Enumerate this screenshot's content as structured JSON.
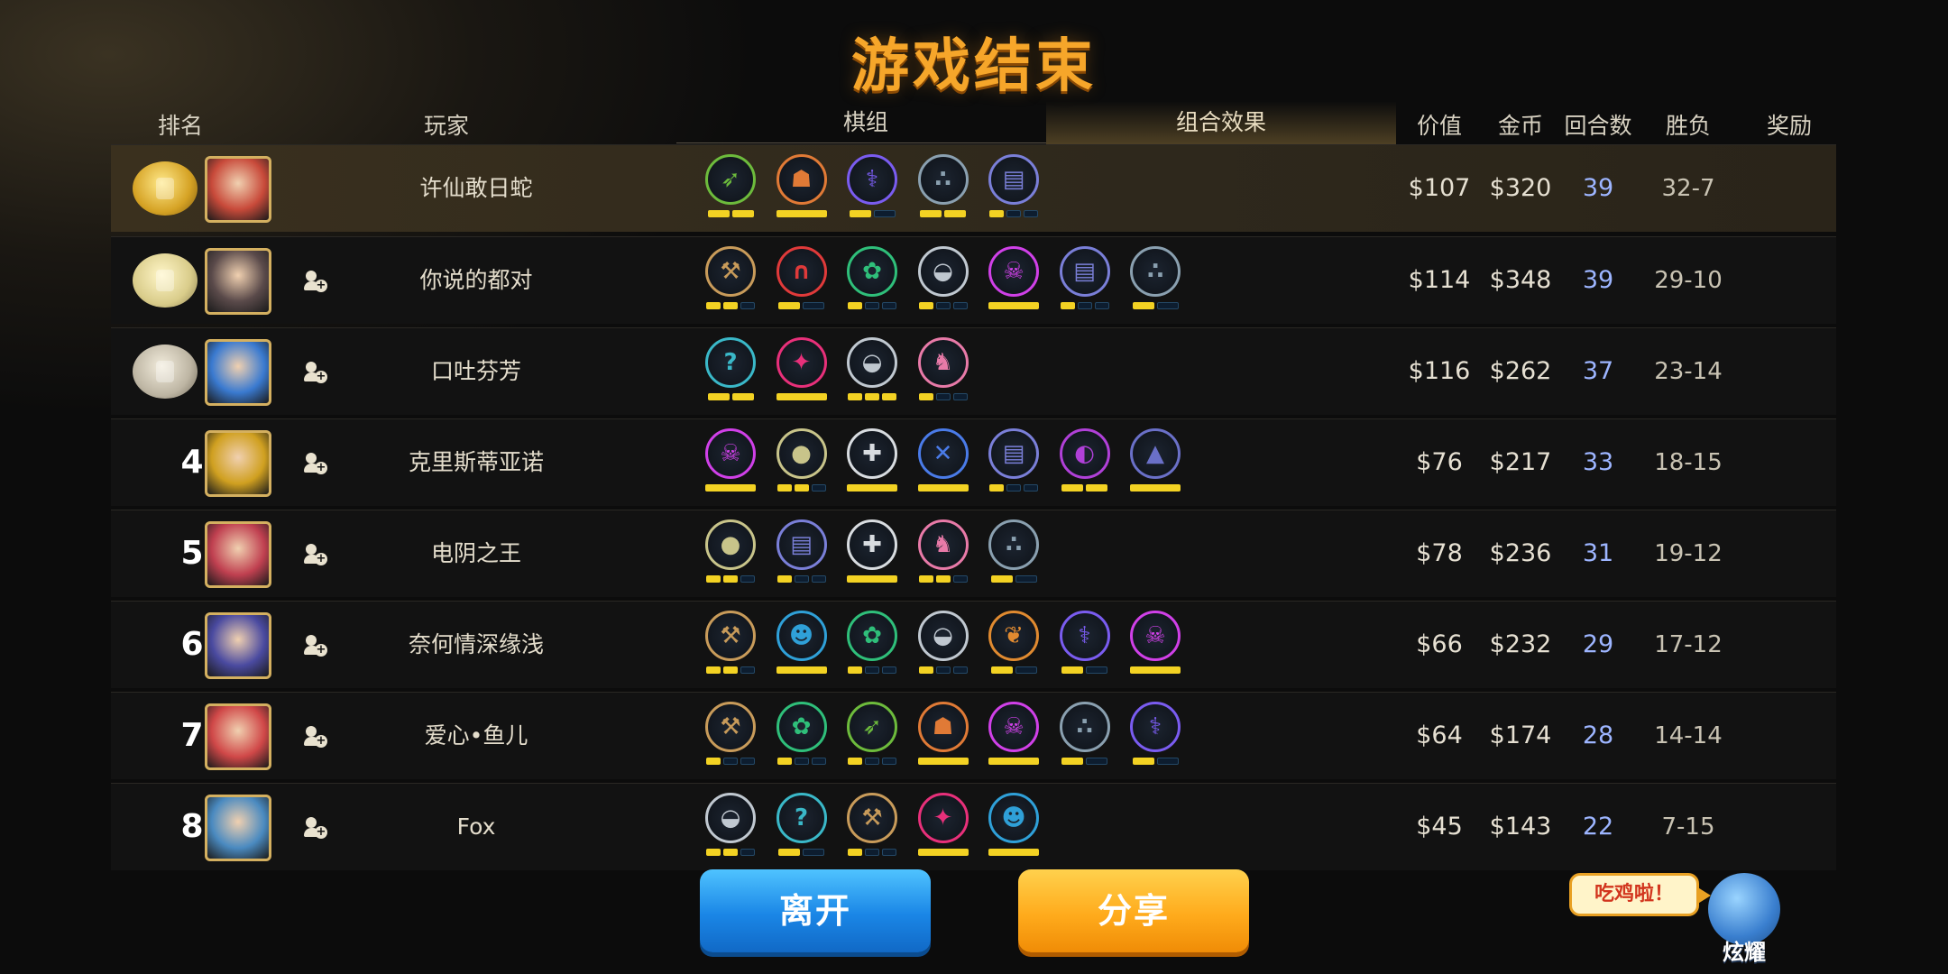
{
  "title": "游戏结束",
  "headers": {
    "rank": "排名",
    "player": "玩家",
    "lineup": "棋组",
    "synergy": "组合效果",
    "value": "价值",
    "gold": "金币",
    "rounds": "回合数",
    "winloss": "胜负",
    "reward": "奖励"
  },
  "colors": {
    "accent_orange": "#f6a62a",
    "pip_on": "#f3d223",
    "rounds_blue": "#9db5ff",
    "leave_button": "#1a86e6",
    "share_button": "#ffab1c"
  },
  "players": [
    {
      "rank": "1",
      "medal": "gold",
      "name": "许仙敢日蛇",
      "add_friend": false,
      "value": "$107",
      "gold": "$320",
      "rounds": "39",
      "winloss": "32-7",
      "traits": [
        {
          "icon": "ranger-bow-icon",
          "color": "#6dbb3c",
          "pips": [
            1,
            1
          ]
        },
        {
          "icon": "viking-helmet-icon",
          "color": "#e07a36",
          "pips": [
            1
          ]
        },
        {
          "icon": "fishbone-icon",
          "color": "#7a5cf0",
          "pips": [
            1,
            0
          ]
        },
        {
          "icon": "pawprints-icon",
          "color": "#8aa0b0",
          "pips": [
            1,
            1
          ]
        },
        {
          "icon": "spellbook-icon",
          "color": "#7a7fd8",
          "pips": [
            1,
            0,
            0
          ]
        }
      ]
    },
    {
      "rank": "2",
      "medal": "silver",
      "name": "你说的都对",
      "add_friend": true,
      "value": "$114",
      "gold": "$348",
      "rounds": "39",
      "winloss": "29-10",
      "traits": [
        {
          "icon": "axe-icon",
          "color": "#c89b5a",
          "pips": [
            1,
            1,
            0
          ]
        },
        {
          "icon": "arch-icon",
          "color": "#e03a3a",
          "pips": [
            1,
            0
          ]
        },
        {
          "icon": "paw-icon",
          "color": "#2fbf7a",
          "pips": [
            1,
            0,
            0
          ]
        },
        {
          "icon": "helmet-icon",
          "color": "#c0c8d0",
          "pips": [
            1,
            0,
            0
          ]
        },
        {
          "icon": "demon-skull-icon",
          "color": "#d040e8",
          "pips": [
            1
          ]
        },
        {
          "icon": "spellbook-icon",
          "color": "#7a7fd8",
          "pips": [
            1,
            0,
            0
          ]
        },
        {
          "icon": "pawprints-icon",
          "color": "#8aa0b0",
          "pips": [
            1,
            0
          ]
        }
      ]
    },
    {
      "rank": "3",
      "medal": "bronze",
      "name": "口吐芬芳",
      "add_friend": true,
      "value": "$116",
      "gold": "$262",
      "rounds": "37",
      "winloss": "23-14",
      "traits": [
        {
          "icon": "hook-icon",
          "color": "#3ab8c8",
          "pips": [
            1,
            1
          ]
        },
        {
          "icon": "bat-icon",
          "color": "#e8307a",
          "pips": [
            1
          ]
        },
        {
          "icon": "helmet-icon",
          "color": "#c0c8d0",
          "pips": [
            1,
            1,
            1
          ]
        },
        {
          "icon": "knight-horse-icon",
          "color": "#e87aa8",
          "pips": [
            1,
            0,
            0
          ]
        }
      ]
    },
    {
      "rank": "4",
      "medal": "",
      "name": "克里斯蒂亚诺",
      "add_friend": true,
      "value": "$76",
      "gold": "$217",
      "rounds": "33",
      "winloss": "18-15",
      "traits": [
        {
          "icon": "demon-skull-icon",
          "color": "#d040e8",
          "pips": [
            1
          ]
        },
        {
          "icon": "penguin-icon",
          "color": "#c8c48a",
          "pips": [
            1,
            1,
            0
          ]
        },
        {
          "icon": "cross-icon",
          "color": "#d8dce0",
          "pips": [
            1
          ]
        },
        {
          "icon": "blades-icon",
          "color": "#4a7be8",
          "pips": [
            1
          ]
        },
        {
          "icon": "spellbook-icon",
          "color": "#7a7fd8",
          "pips": [
            1,
            0,
            0
          ]
        },
        {
          "icon": "shadow-icon",
          "color": "#b040d8",
          "pips": [
            1,
            1
          ]
        },
        {
          "icon": "wizard-hat-icon",
          "color": "#6a70c8",
          "pips": [
            1
          ]
        }
      ]
    },
    {
      "rank": "5",
      "medal": "",
      "name": "电阴之王",
      "add_friend": true,
      "value": "$78",
      "gold": "$236",
      "rounds": "31",
      "winloss": "19-12",
      "traits": [
        {
          "icon": "penguin-icon",
          "color": "#c8c48a",
          "pips": [
            1,
            1,
            0
          ]
        },
        {
          "icon": "spellbook-icon",
          "color": "#7a7fd8",
          "pips": [
            1,
            0,
            0
          ]
        },
        {
          "icon": "cross-icon",
          "color": "#d8dce0",
          "pips": [
            1
          ]
        },
        {
          "icon": "knight-horse-icon",
          "color": "#e87aa8",
          "pips": [
            1,
            1,
            0
          ]
        },
        {
          "icon": "pawprints-icon",
          "color": "#8aa0b0",
          "pips": [
            1,
            0
          ]
        }
      ]
    },
    {
      "rank": "6",
      "medal": "",
      "name": "奈何情深缘浅",
      "add_friend": true,
      "value": "$66",
      "gold": "$232",
      "rounds": "29",
      "winloss": "17-12",
      "traits": [
        {
          "icon": "axe-icon",
          "color": "#c89b5a",
          "pips": [
            1,
            1,
            0
          ]
        },
        {
          "icon": "pumpkin-icon",
          "color": "#2fa0d8",
          "pips": [
            1
          ]
        },
        {
          "icon": "paw-icon",
          "color": "#2fbf7a",
          "pips": [
            1,
            0,
            0
          ]
        },
        {
          "icon": "helmet-icon",
          "color": "#c0c8d0",
          "pips": [
            1,
            0,
            0
          ]
        },
        {
          "icon": "leaf-icon",
          "color": "#e08a30",
          "pips": [
            1,
            0
          ]
        },
        {
          "icon": "fishbone-icon",
          "color": "#7a5cf0",
          "pips": [
            1,
            0
          ]
        },
        {
          "icon": "demon-skull-icon",
          "color": "#d040e8",
          "pips": [
            1
          ]
        }
      ]
    },
    {
      "rank": "7",
      "medal": "",
      "name": "爱心•鱼儿",
      "add_friend": true,
      "value": "$64",
      "gold": "$174",
      "rounds": "28",
      "winloss": "14-14",
      "traits": [
        {
          "icon": "axe-icon",
          "color": "#c89b5a",
          "pips": [
            1,
            0,
            0
          ]
        },
        {
          "icon": "paw-icon",
          "color": "#2fbf7a",
          "pips": [
            1,
            0,
            0
          ]
        },
        {
          "icon": "ranger-bow-icon",
          "color": "#6dbb3c",
          "pips": [
            1,
            0,
            0
          ]
        },
        {
          "icon": "viking-helmet-icon",
          "color": "#e07a36",
          "pips": [
            1
          ]
        },
        {
          "icon": "demon-skull-icon",
          "color": "#d040e8",
          "pips": [
            1
          ]
        },
        {
          "icon": "pawprints-icon",
          "color": "#8aa0b0",
          "pips": [
            1,
            0
          ]
        },
        {
          "icon": "fishbone-icon",
          "color": "#7a5cf0",
          "pips": [
            1,
            0
          ]
        }
      ]
    },
    {
      "rank": "8",
      "medal": "",
      "name": "Fox",
      "add_friend": true,
      "value": "$45",
      "gold": "$143",
      "rounds": "22",
      "winloss": "7-15",
      "traits": [
        {
          "icon": "helmet-icon",
          "color": "#c0c8d0",
          "pips": [
            1,
            1,
            0
          ]
        },
        {
          "icon": "hook-icon",
          "color": "#3ab8c8",
          "pips": [
            1,
            0
          ]
        },
        {
          "icon": "axe-icon",
          "color": "#c89b5a",
          "pips": [
            1,
            0,
            0
          ]
        },
        {
          "icon": "bat-icon",
          "color": "#e8307a",
          "pips": [
            1
          ]
        },
        {
          "icon": "pumpkin-icon",
          "color": "#2fa0d8",
          "pips": [
            1
          ]
        }
      ]
    }
  ],
  "buttons": {
    "leave": "离开",
    "share": "分享"
  },
  "mascot": {
    "bubble": "吃鸡啦！",
    "label": "炫耀"
  }
}
